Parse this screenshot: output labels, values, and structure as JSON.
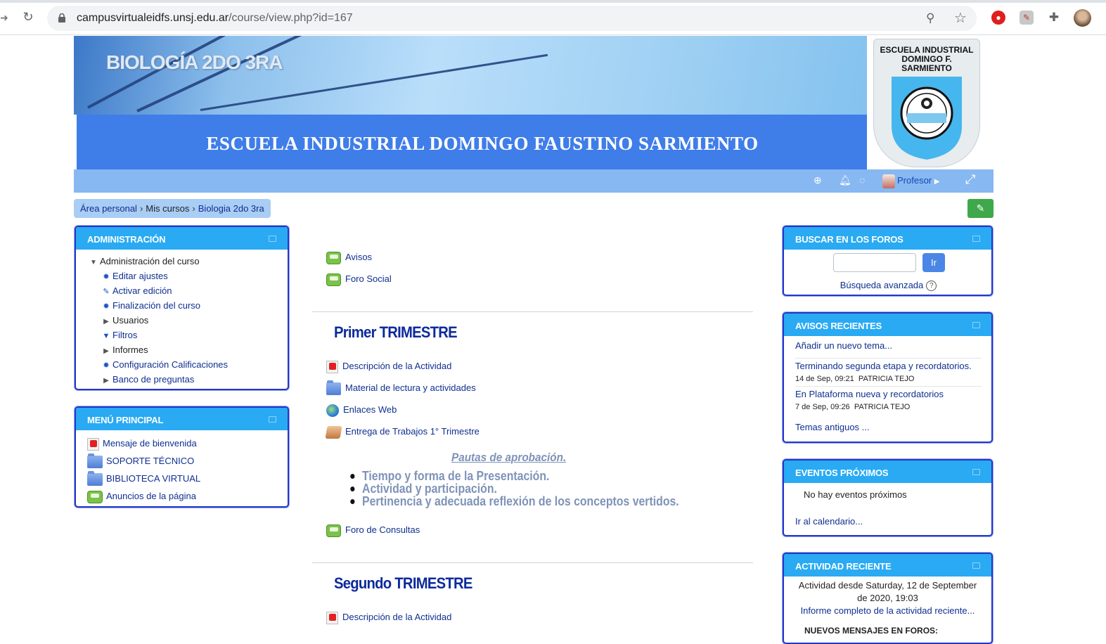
{
  "browser": {
    "url_host": "campusvirtualeidfs.unsj.edu.ar",
    "url_path": "/course/view.php?id=167"
  },
  "banner": {
    "course_name": "BIOLOGÍA 2DO 3RA",
    "school_name": "ESCUELA INDUSTRIAL DOMINGO FAUSTINO SARMIENTO",
    "logo_line1": "ESCUELA INDUSTRIAL",
    "logo_line2": "DOMINGO F. SARMIENTO"
  },
  "navbar": {
    "user_label": "Profesor"
  },
  "breadcrumb": {
    "items": [
      "Área personal",
      "Mis cursos",
      "Biologia 2do 3ra"
    ]
  },
  "admin_block": {
    "title": "ADMINISTRACIÓN",
    "root": "Administración del curso",
    "items": [
      {
        "label": "Editar ajustes",
        "icon": "gear-icon"
      },
      {
        "label": "Activar edición",
        "icon": "pencil-icon"
      },
      {
        "label": "Finalización del curso",
        "icon": "gear-icon"
      },
      {
        "label": "Usuarios",
        "icon": "caret-right-icon"
      },
      {
        "label": "Filtros",
        "icon": "filter-icon"
      },
      {
        "label": "Informes",
        "icon": "caret-right-icon"
      },
      {
        "label": "Configuración Calificaciones",
        "icon": "gear-icon"
      },
      {
        "label": "Banco de preguntas",
        "icon": "caret-right-icon"
      }
    ]
  },
  "main_menu_block": {
    "title": "MENÚ PRINCIPAL",
    "items": [
      {
        "label": "Mensaje de bienvenida",
        "icon": "pdf-icon"
      },
      {
        "label": "SOPORTE TÉCNICO",
        "icon": "folder-icon"
      },
      {
        "label": "BIBLIOTECA VIRTUAL",
        "icon": "folder-icon"
      },
      {
        "label": "Anuncios de la página",
        "icon": "forum-icon"
      }
    ]
  },
  "course": {
    "general": [
      {
        "label": "Avisos",
        "icon": "forum-icon"
      },
      {
        "label": "Foro Social",
        "icon": "forum-icon"
      }
    ],
    "section1": {
      "title": "Primer TRIMESTRE",
      "activities": [
        {
          "label": "Descripción de la Actividad",
          "icon": "pdf-icon"
        },
        {
          "label": "Material de lectura y actividades",
          "icon": "folder-icon"
        },
        {
          "label": "Enlaces Web",
          "icon": "web-icon"
        },
        {
          "label": "Entrega de Trabajos 1° Trimestre",
          "icon": "assignment-icon"
        }
      ],
      "pautas_title": "Pautas de aprobación.",
      "pautas": [
        "Tiempo y forma de la Presentación.",
        "Actividad y participación.",
        "Pertinencia y adecuada reflexión de los conceptos vertidos."
      ],
      "forum": "Foro de Consultas"
    },
    "section2": {
      "title": "Segundo TRIMESTRE",
      "activities": [
        {
          "label": "Descripción de la Actividad",
          "icon": "pdf-icon"
        }
      ]
    }
  },
  "search_block": {
    "title": "BUSCAR EN LOS FOROS",
    "button": "Ir",
    "advanced": "Búsqueda avanzada"
  },
  "news_block": {
    "title": "AVISOS RECIENTES",
    "add": "Añadir un nuevo tema...",
    "posts": [
      {
        "title": "Terminando segunda etapa y recordatorios.",
        "date": "14 de Sep, 09:21",
        "author": "PATRICIA TEJO"
      },
      {
        "title": "En Plataforma nueva y recordatorios",
        "date": "7 de Sep, 09:26",
        "author": "PATRICIA TEJO"
      }
    ],
    "older": "Temas antiguos ..."
  },
  "events_block": {
    "title": "EVENTOS PRÓXIMOS",
    "empty": "No hay eventos próximos",
    "calendar": "Ir al calendario..."
  },
  "activity_block": {
    "title": "ACTIVIDAD RECIENTE",
    "since_line1": "Actividad desde Saturday, 12 de September",
    "since_line2": "de 2020, 19:03",
    "full_report": "Informe completo de la actividad reciente...",
    "new_posts": "NUEVOS MENSAJES EN FOROS:"
  },
  "colors": {
    "block_header": "#29aaf3",
    "block_border": "#2238c7",
    "navbar": "#87b8f1",
    "banner_band": "#3f7de9",
    "section_title": "#0d2a9c",
    "edit_button": "#3ea84a"
  }
}
